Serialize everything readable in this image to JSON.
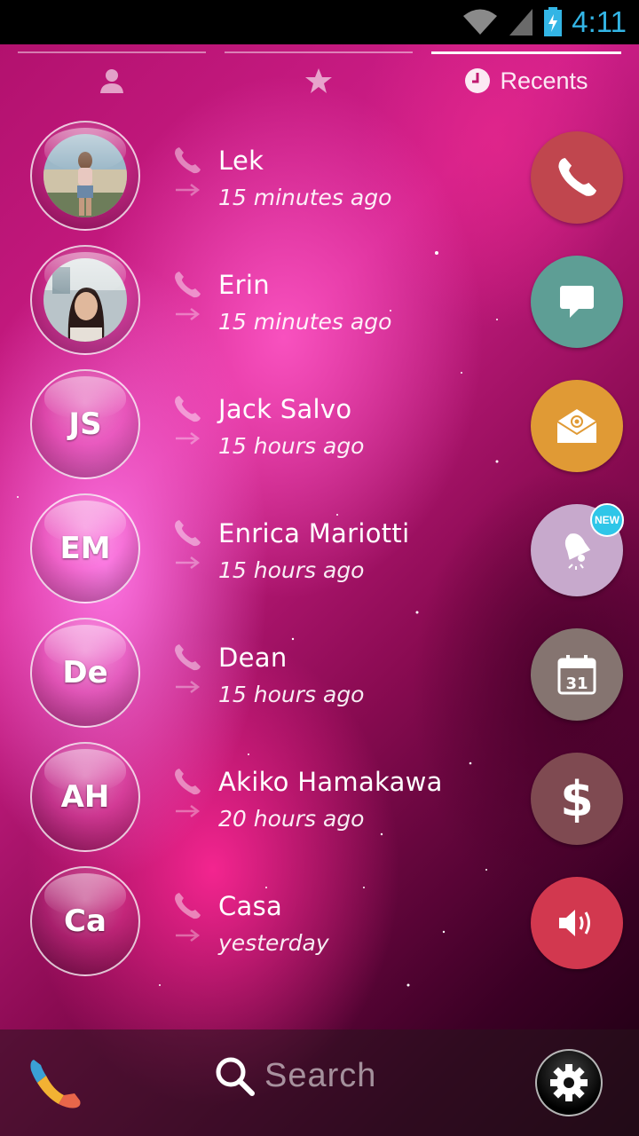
{
  "status_bar": {
    "time": "4:11"
  },
  "tabs": [
    {
      "name": "contacts",
      "icon": "person-icon",
      "label": ""
    },
    {
      "name": "favorites",
      "icon": "star-icon",
      "label": ""
    },
    {
      "name": "recents",
      "icon": "clock-icon",
      "label": "Recents",
      "active": true
    }
  ],
  "recents": [
    {
      "name": "Lek",
      "time": "15 minutes ago",
      "initials": "",
      "photo": true
    },
    {
      "name": "Erin",
      "time": "15 minutes ago",
      "initials": "",
      "photo": true
    },
    {
      "name": "Jack Salvo",
      "time": "15 hours ago",
      "initials": "JS"
    },
    {
      "name": "Enrica Mariotti",
      "time": "15 hours ago",
      "initials": "EM"
    },
    {
      "name": "Dean",
      "time": "15 hours ago",
      "initials": "De"
    },
    {
      "name": "Akiko Hamakawa",
      "time": "20 hours ago",
      "initials": "AH"
    },
    {
      "name": "Casa",
      "time": "yesterday",
      "initials": "Ca"
    }
  ],
  "actions": [
    {
      "name": "call",
      "icon": "phone-icon",
      "color": "#c0464e"
    },
    {
      "name": "message",
      "icon": "chat-icon",
      "color": "#5e9e95"
    },
    {
      "name": "email",
      "icon": "envelope-icon",
      "color": "#e09a35"
    },
    {
      "name": "reminder",
      "icon": "bell-icon",
      "color": "#c7a9cc",
      "badge": "NEW"
    },
    {
      "name": "calendar",
      "icon": "calendar-icon",
      "color": "#857470",
      "calendar_day": "31"
    },
    {
      "name": "payment",
      "icon": "dollar-icon",
      "color": "#7f4a51",
      "glyph": "$"
    },
    {
      "name": "volume",
      "icon": "speaker-icon",
      "color": "#d2384f"
    }
  ],
  "bottom_bar": {
    "search_placeholder": "Search"
  }
}
